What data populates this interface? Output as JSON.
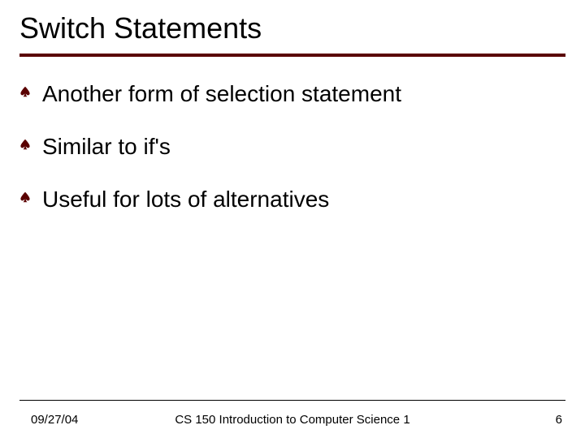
{
  "title": "Switch Statements",
  "bullets": [
    "Another form of selection statement",
    "Similar to if's",
    "Useful for lots of alternatives"
  ],
  "footer": {
    "date": "09/27/04",
    "course": "CS 150 Introduction to Computer Science 1",
    "page": "6"
  },
  "colors": {
    "accent": "#5a0000"
  }
}
